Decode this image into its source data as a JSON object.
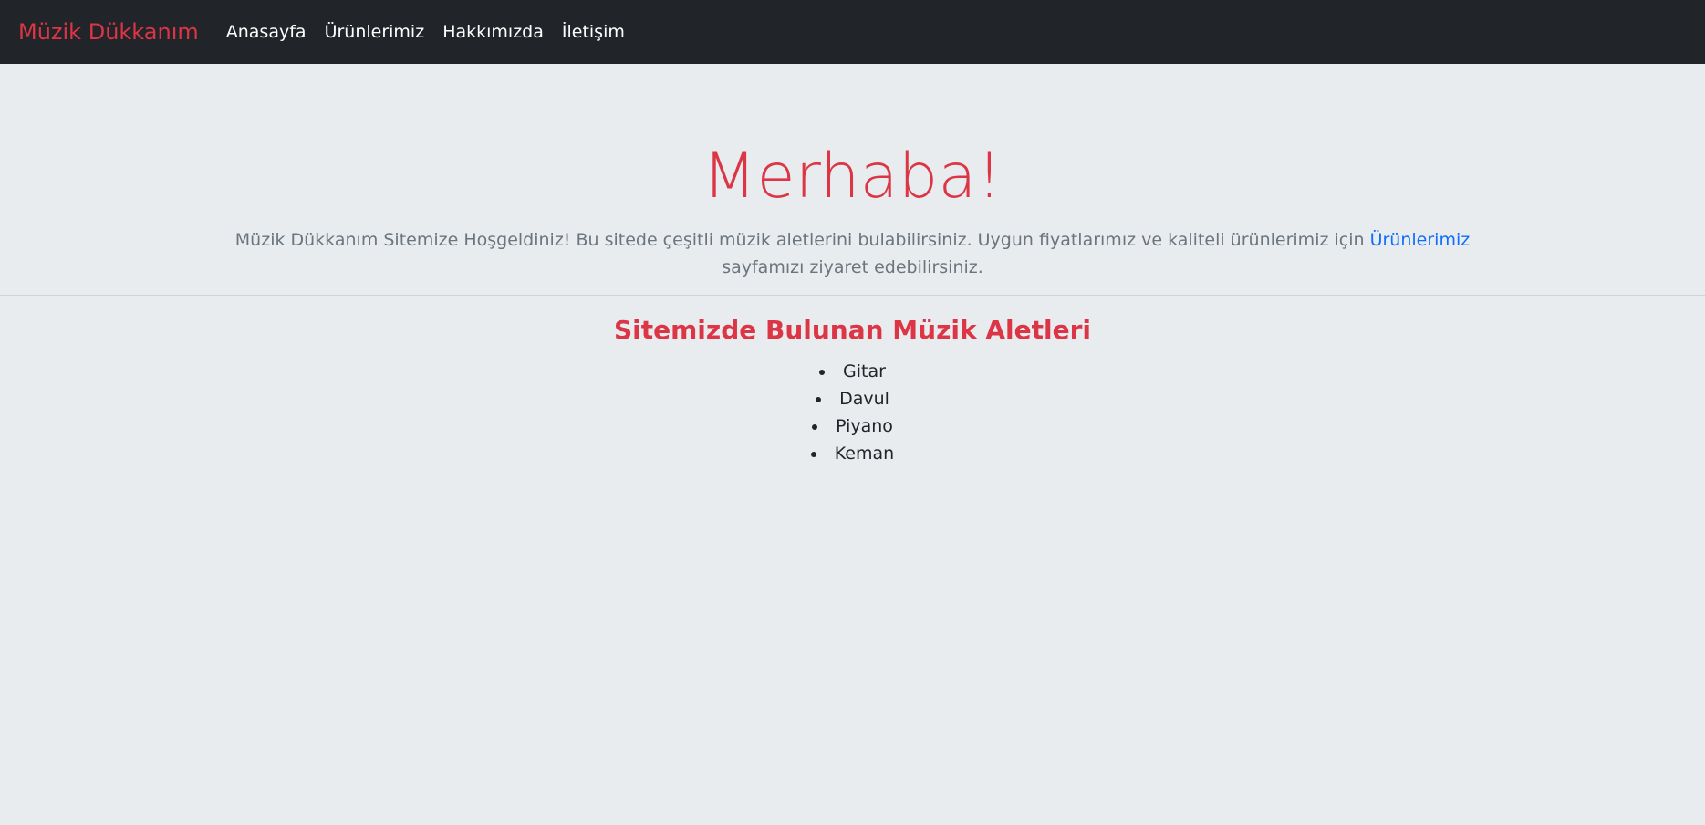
{
  "nav": {
    "brand": "Müzik Dükkanım",
    "links": [
      "Anasayfa",
      "Ürünlerimiz",
      "Hakkımızda",
      "İletişim"
    ]
  },
  "hero": {
    "title": "Merhaba!",
    "text_before_link": "Müzik Dükkanım Sitemize Hoşgeldiniz! Bu sitede çeşitli müzik aletlerini bulabilirsiniz. Uygun fiyatlarımız ve kaliteli ürünlerimiz için ",
    "link_text": "Ürünlerimiz",
    "text_after_link": " sayfamızı ziyaret edebilirsiniz."
  },
  "instruments": {
    "title": "Sitemizde Bulunan Müzik Aletleri",
    "items": [
      "Gitar",
      "Davul",
      "Piyano",
      "Keman"
    ]
  },
  "colors": {
    "accent": "#dc3545",
    "link": "#0d6efd",
    "navbar": "#212529",
    "background": "#e9ecef"
  }
}
